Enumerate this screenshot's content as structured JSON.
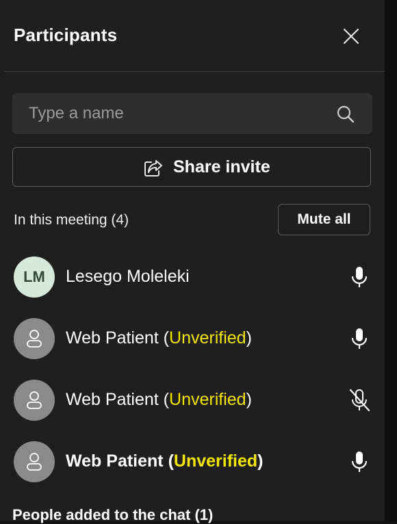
{
  "panel": {
    "title": "Participants",
    "search": {
      "placeholder": "Type a name"
    },
    "share_label": "Share invite",
    "section_label": "In this meeting (4)",
    "mute_all_label": "Mute all"
  },
  "participants": [
    {
      "initials": "LM",
      "name": "Lesego Moleleki",
      "tag": "",
      "mic": "on"
    },
    {
      "initials": "",
      "name": "Web Patient",
      "tag": "Unverified",
      "mic": "on"
    },
    {
      "initials": "",
      "name": "Web Patient",
      "tag": "Unverified",
      "mic": "muted"
    },
    {
      "initials": "",
      "name": "Web Patient",
      "tag": "Unverified",
      "mic": "on"
    }
  ],
  "next_section_label": "People added to the chat (1)",
  "colors": {
    "panel_bg": "#1f1f1f",
    "unverified_highlight": "#f2e600",
    "avatar_initials_bg": "#d5e9dc",
    "avatar_generic_bg": "#8a8a8a"
  },
  "icons": {
    "close": "close-icon",
    "search": "search-icon",
    "share": "share-icon",
    "mic": "microphone-icon",
    "mic_muted": "microphone-muted-icon",
    "person": "person-icon"
  }
}
